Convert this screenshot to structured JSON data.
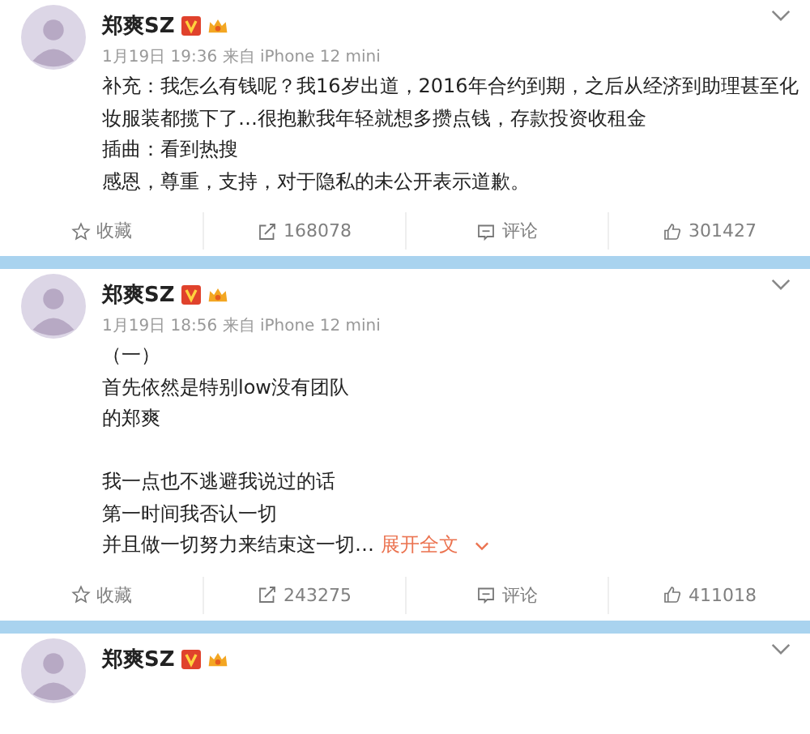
{
  "posts": [
    {
      "author": "郑爽SZ",
      "meta": "1月19日 19:36 来自 iPhone 12 mini",
      "paragraphs": [
        [
          "补充：我怎么有钱呢？我16岁出道，2016年合约到期，之后从经济到助理甚至化妆服装都揽下了…很抱歉我年轻就想多攒点钱，存款投资收租金",
          "插曲：看到热搜",
          "感恩，尊重，支持，对于隐私的未公开表示道歉。"
        ]
      ],
      "actions": [
        {
          "kind": "star",
          "label": "收藏"
        },
        {
          "kind": "share",
          "label": "168078"
        },
        {
          "kind": "comment",
          "label": "评论"
        },
        {
          "kind": "like",
          "label": "301427"
        }
      ]
    },
    {
      "author": "郑爽SZ",
      "meta": "1月19日 18:56 来自 iPhone 12 mini",
      "paragraphs": [
        [
          "（一）",
          "首先依然是特别low没有团队",
          "的郑爽"
        ],
        [
          "我一点也不逃避我说过的话",
          "第一时间我否认一切",
          "并且做一切努力来结束这一切…"
        ]
      ],
      "more_link": "展开全文",
      "actions": [
        {
          "kind": "star",
          "label": "收藏"
        },
        {
          "kind": "share",
          "label": "243275"
        },
        {
          "kind": "comment",
          "label": "评论"
        },
        {
          "kind": "like",
          "label": "411018"
        }
      ]
    },
    {
      "author": "郑爽SZ"
    }
  ]
}
